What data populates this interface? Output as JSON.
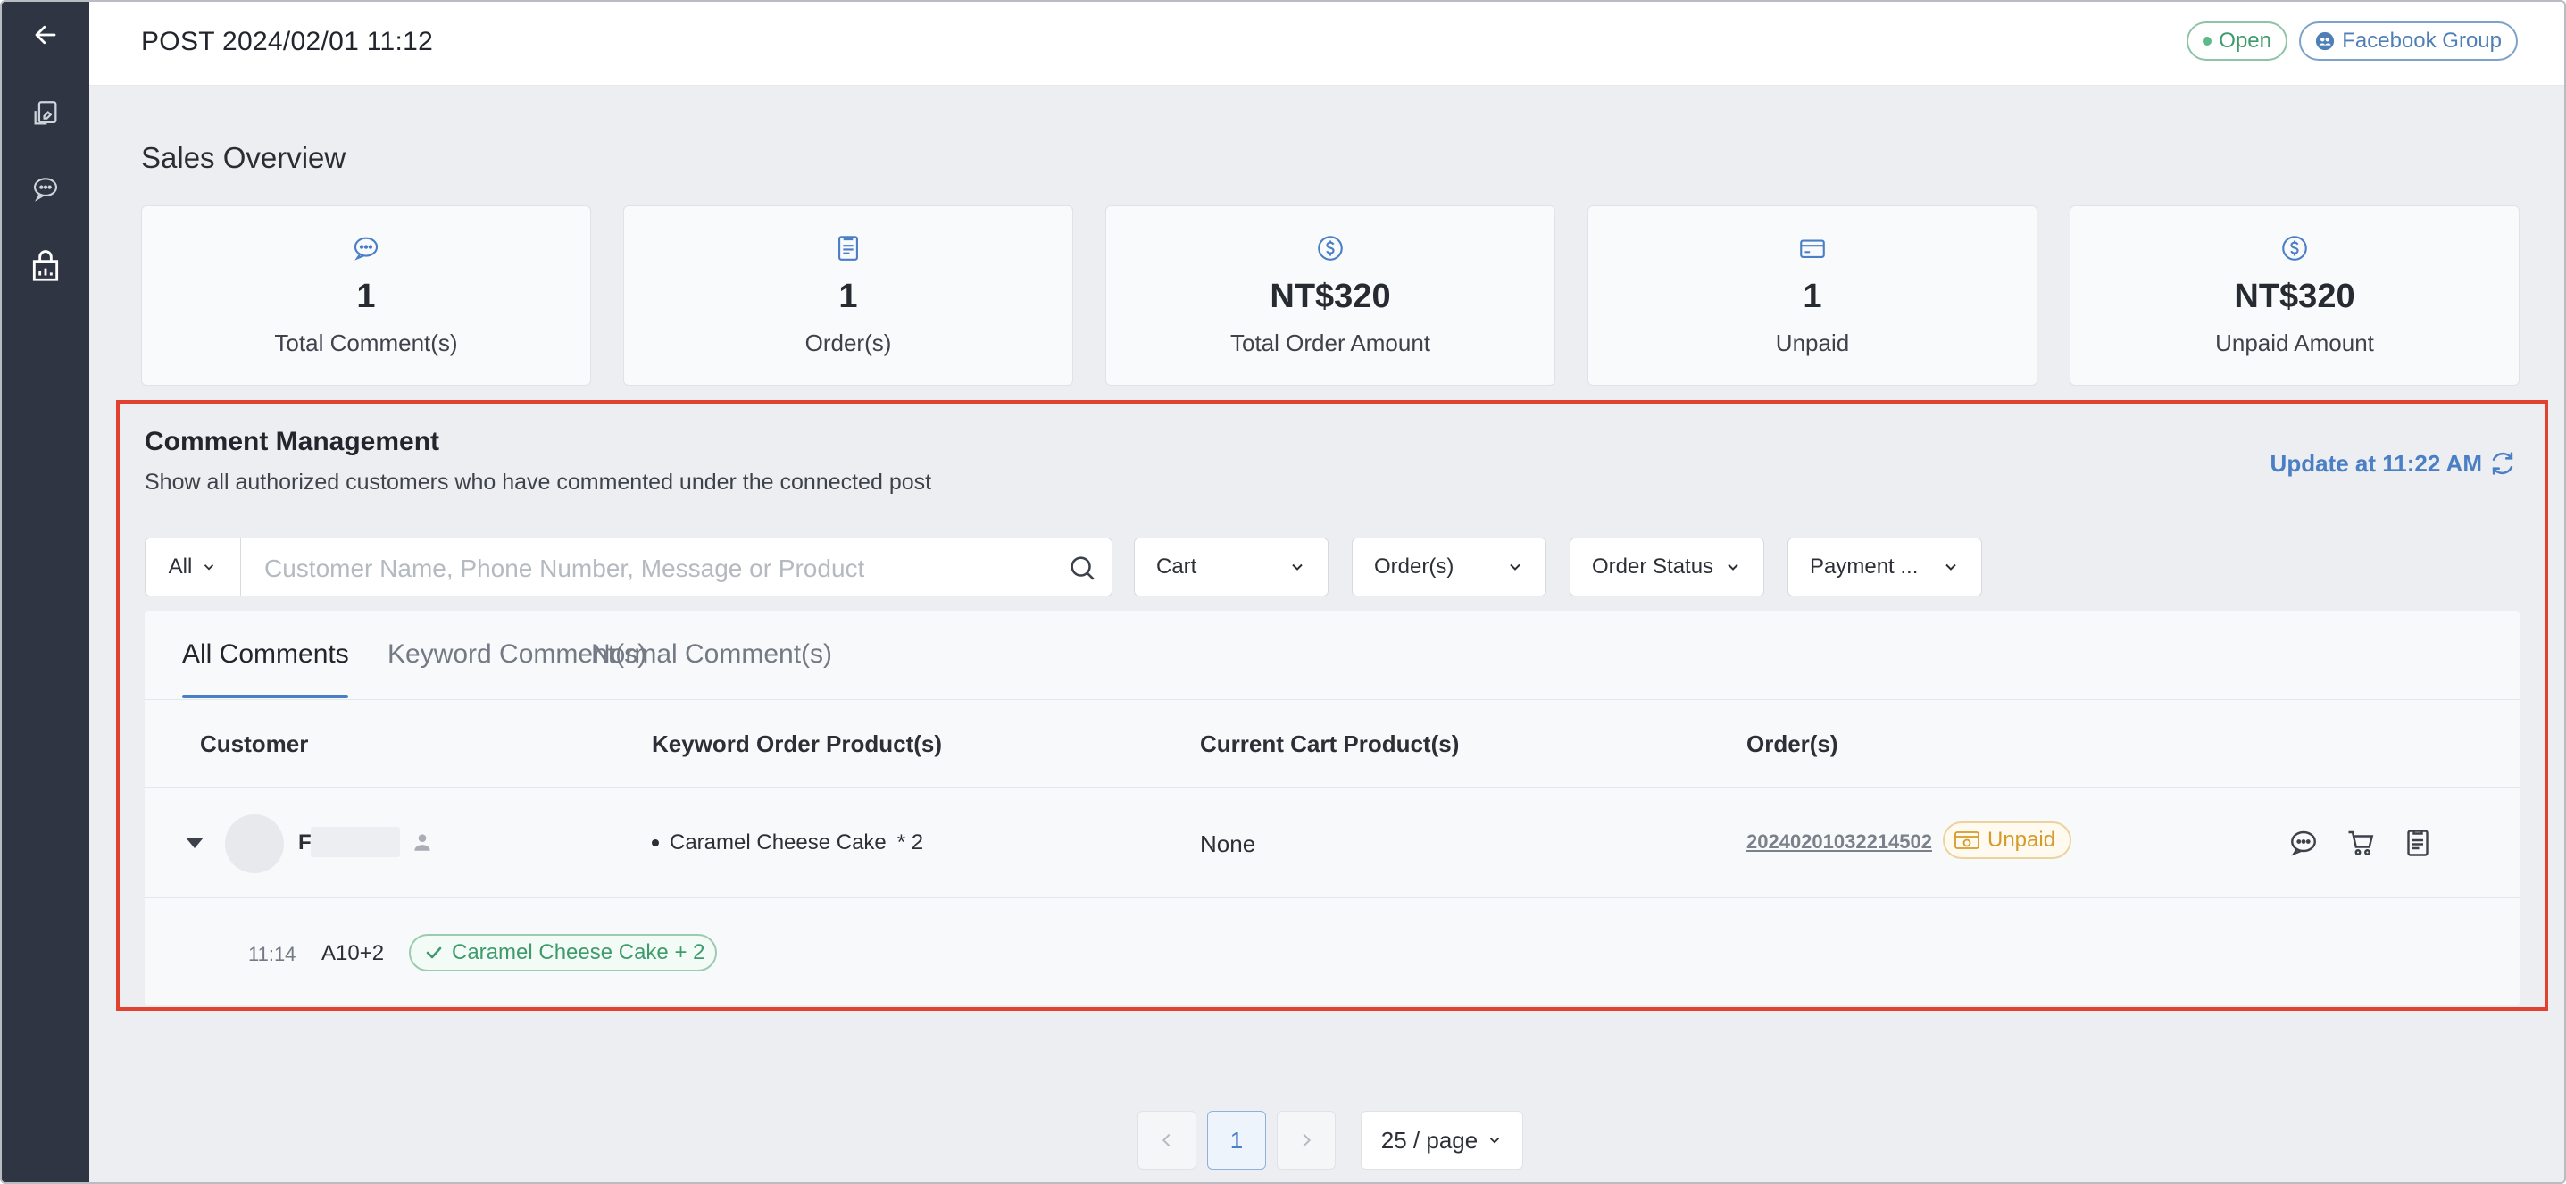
{
  "header": {
    "post_title": "POST 2024/02/01 11:12",
    "status_label": "Open",
    "source_label": "Facebook Group"
  },
  "overview": {
    "title": "Sales Overview",
    "cards": [
      {
        "icon": "comment-icon",
        "value": "1",
        "label": "Total Comment(s)"
      },
      {
        "icon": "order-icon",
        "value": "1",
        "label": "Order(s)"
      },
      {
        "icon": "dollar-icon",
        "value": "NT$320",
        "label": "Total Order Amount"
      },
      {
        "icon": "card-icon",
        "value": "1",
        "label": "Unpaid"
      },
      {
        "icon": "dollar-icon",
        "value": "NT$320",
        "label": "Unpaid Amount"
      }
    ]
  },
  "comments": {
    "title": "Comment Management",
    "subtitle": "Show all authorized customers who have commented under the connected post",
    "update_label": "Update at 11:22 AM",
    "scope_value": "All",
    "search_placeholder": "Customer Name, Phone Number, Message or Product",
    "filters": [
      "Cart",
      "Order(s)",
      "Order Status",
      "Payment ..."
    ],
    "tabs": [
      "All Comments",
      "Keyword Comment(s)",
      "Normal Comment(s)"
    ],
    "columns": [
      "Customer",
      "Keyword Order Product(s)",
      "Current Cart Product(s)",
      "Order(s)"
    ],
    "row": {
      "customer_initial": "F",
      "keyword_product": "Caramel Cheese Cake",
      "keyword_qty": "* 2",
      "cart": "None",
      "order_number": "20240201032214502",
      "order_status": "Unpaid"
    },
    "detail": {
      "time": "11:14",
      "message": "A10+2",
      "matched": "Caramel Cheese Cake + 2"
    }
  },
  "pagination": {
    "current_page": "1",
    "page_size": "25 / page"
  }
}
